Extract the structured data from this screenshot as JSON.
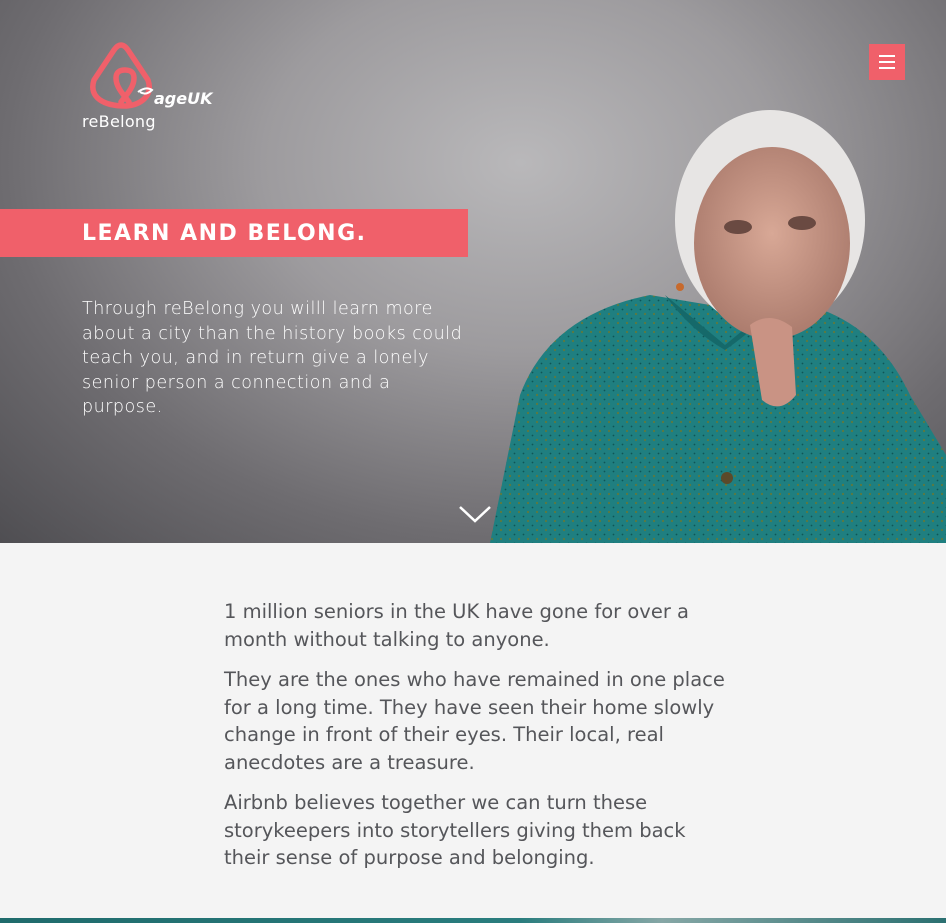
{
  "header": {
    "logo_partner_text": "ageUK",
    "brand_name": "reBelong",
    "menu_icon": "hamburger-icon"
  },
  "hero": {
    "headline": "LEARN AND BELONG.",
    "intro": "Through reBelong you willl learn more about a city than the history books could teach you, and in return give a lonely senior person a connection and a purpose.",
    "scroll_icon": "chevron-down-icon"
  },
  "content": {
    "paragraphs": [
      "1 million seniors in the UK have gone for over a month without talking to anyone.",
      "They are the ones who have remained in one place for a long time. They have seen their home slowly change in front of their eyes. Their local, real anecdotes are a treasure.",
      "Airbnb believes together we can turn these storykeepers into storytellers giving them back their sense of purpose and belonging."
    ]
  },
  "colors": {
    "accent": "#f0606a",
    "hero_bg": "#8f8e91",
    "content_bg": "#f4f4f4",
    "body_text": "#55565a"
  }
}
